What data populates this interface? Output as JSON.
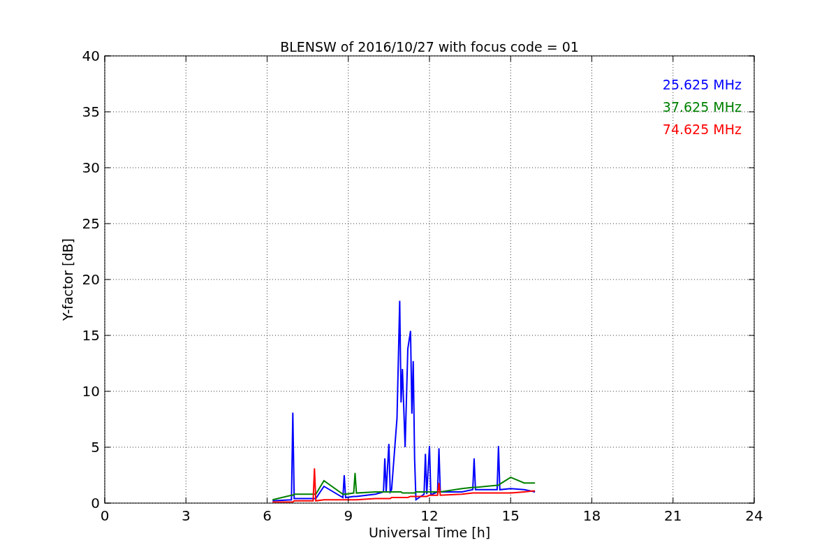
{
  "chart_data": {
    "type": "line",
    "title": "BLENSW of 2016/10/27 with focus code = 01",
    "xlabel": "Universal Time [h]",
    "ylabel": "Y-factor [dB]",
    "grid": true,
    "xlim": [
      0,
      24
    ],
    "ylim": [
      0,
      40
    ],
    "xticks": [
      0,
      3,
      6,
      9,
      12,
      15,
      18,
      21,
      24
    ],
    "yticks": [
      0,
      5,
      10,
      15,
      20,
      25,
      30,
      35,
      40
    ],
    "x": [
      6.2,
      6.9,
      6.95,
      7.0,
      7.7,
      7.75,
      7.8,
      8.1,
      8.8,
      8.85,
      8.9,
      9.2,
      9.25,
      9.3,
      10.0,
      10.3,
      10.35,
      10.4,
      10.5,
      10.55,
      10.6,
      10.8,
      10.9,
      10.95,
      11.0,
      11.1,
      11.2,
      11.3,
      11.35,
      11.4,
      11.45,
      11.5,
      11.8,
      11.85,
      11.9,
      12.0,
      12.05,
      12.1,
      12.3,
      12.35,
      12.4,
      13.2,
      13.6,
      13.65,
      13.7,
      14.5,
      14.55,
      14.6,
      15.0,
      15.5,
      15.9
    ],
    "series": [
      {
        "name": "25.625 MHz",
        "color": "#0000ff",
        "values": [
          0.2,
          0.3,
          8.1,
          0.4,
          0.4,
          0.4,
          0.4,
          1.5,
          0.5,
          2.5,
          0.5,
          0.6,
          0.6,
          0.6,
          0.8,
          1.0,
          4.0,
          1.0,
          5.3,
          1.0,
          1.2,
          7.6,
          18.1,
          9.0,
          12.0,
          5.0,
          13.8,
          15.4,
          8.0,
          12.7,
          4.0,
          0.3,
          0.8,
          4.4,
          0.8,
          5.1,
          0.8,
          0.8,
          1.0,
          4.9,
          1.0,
          1.0,
          1.2,
          4.0,
          1.2,
          1.2,
          5.1,
          1.2,
          1.3,
          1.2,
          1.0
        ]
      },
      {
        "name": "37.625 MHz",
        "color": "#008000",
        "values": [
          0.3,
          0.7,
          0.7,
          0.8,
          0.8,
          0.8,
          0.8,
          2.0,
          0.8,
          0.8,
          0.8,
          0.9,
          2.7,
          0.9,
          1.0,
          1.0,
          1.0,
          1.0,
          1.0,
          1.0,
          1.0,
          1.0,
          1.0,
          1.0,
          0.9,
          0.9,
          0.9,
          0.9,
          0.9,
          0.9,
          0.9,
          1.0,
          1.0,
          1.0,
          1.0,
          1.0,
          1.0,
          1.0,
          1.0,
          1.0,
          1.0,
          1.3,
          1.4,
          1.4,
          1.4,
          1.6,
          1.6,
          1.7,
          2.3,
          1.8,
          1.8
        ]
      },
      {
        "name": "74.625 MHz",
        "color": "#ff0000",
        "values": [
          0.1,
          0.1,
          0.1,
          0.2,
          0.2,
          3.1,
          0.2,
          0.3,
          0.3,
          0.3,
          0.3,
          0.3,
          0.3,
          0.3,
          0.4,
          0.4,
          0.4,
          0.4,
          0.4,
          0.4,
          0.5,
          0.5,
          0.5,
          0.5,
          0.5,
          0.5,
          0.5,
          0.6,
          0.6,
          0.6,
          0.6,
          0.6,
          0.6,
          0.6,
          0.6,
          0.7,
          0.7,
          0.7,
          0.7,
          1.8,
          0.7,
          0.8,
          0.9,
          0.9,
          0.9,
          0.9,
          0.9,
          0.9,
          0.9,
          1.0,
          1.1
        ]
      }
    ]
  }
}
